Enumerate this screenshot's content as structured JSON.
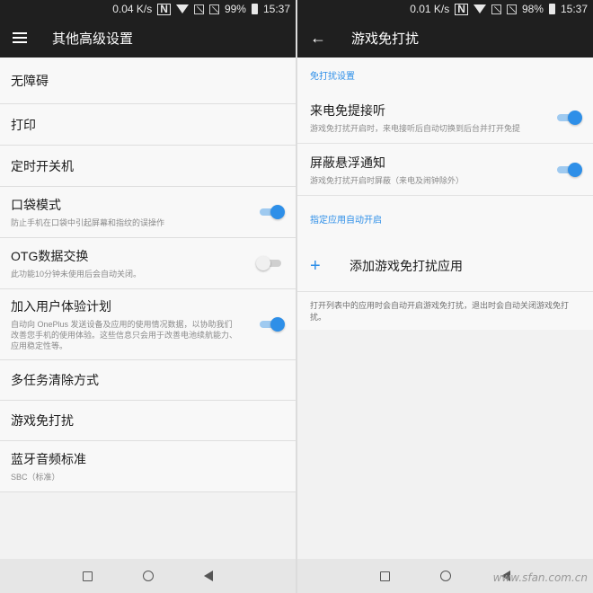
{
  "left": {
    "status": {
      "speed": "0.04 K/s",
      "battery": "99%",
      "time": "15:37"
    },
    "title": "其他高级设置",
    "items": [
      {
        "title": "无障碍"
      },
      {
        "title": "打印"
      },
      {
        "title": "定时开关机"
      },
      {
        "title": "口袋模式",
        "subtitle": "防止手机在口袋中引起屏幕和指纹的误操作",
        "toggle": "on"
      },
      {
        "title": "OTG数据交换",
        "subtitle": "此功能10分钟未使用后会自动关闭。",
        "toggle": "off"
      },
      {
        "title": "加入用户体验计划",
        "subtitle": "自动向 OnePlus 发送设备及应用的使用情况数据，以协助我们改善您手机的使用体验。这些信息只会用于改善电池续航能力、应用稳定性等。",
        "toggle": "on"
      },
      {
        "title": "多任务清除方式"
      },
      {
        "title": "游戏免打扰"
      },
      {
        "title": "蓝牙音频标准",
        "subtitle": "SBC（标准）"
      }
    ]
  },
  "right": {
    "status": {
      "speed": "0.01 K/s",
      "battery": "98%",
      "time": "15:37"
    },
    "title": "游戏免打扰",
    "section1": "免打扰设置",
    "items": [
      {
        "title": "来电免提接听",
        "subtitle": "游戏免打扰开启时，来电接听后自动切换到后台并打开免提",
        "toggle": "on"
      },
      {
        "title": "屏蔽悬浮通知",
        "subtitle": "游戏免打扰开启时屏蔽（来电及闹钟除外）",
        "toggle": "on"
      }
    ],
    "section2": "指定应用自动开启",
    "add_label": "添加游戏免打扰应用",
    "hint": "打开列表中的应用时会自动开启游戏免打扰，退出时会自动关闭游戏免打扰。",
    "watermark": "www.sfan.com.cn"
  },
  "status_icons": [
    "nfc-icon",
    "wifi-icon",
    "no-sim-icon",
    "no-sim-icon",
    "battery-icon"
  ],
  "colors": {
    "accent": "#2e8fe8",
    "appbar": "#1f1f1f",
    "background": "#f8f8f8"
  }
}
